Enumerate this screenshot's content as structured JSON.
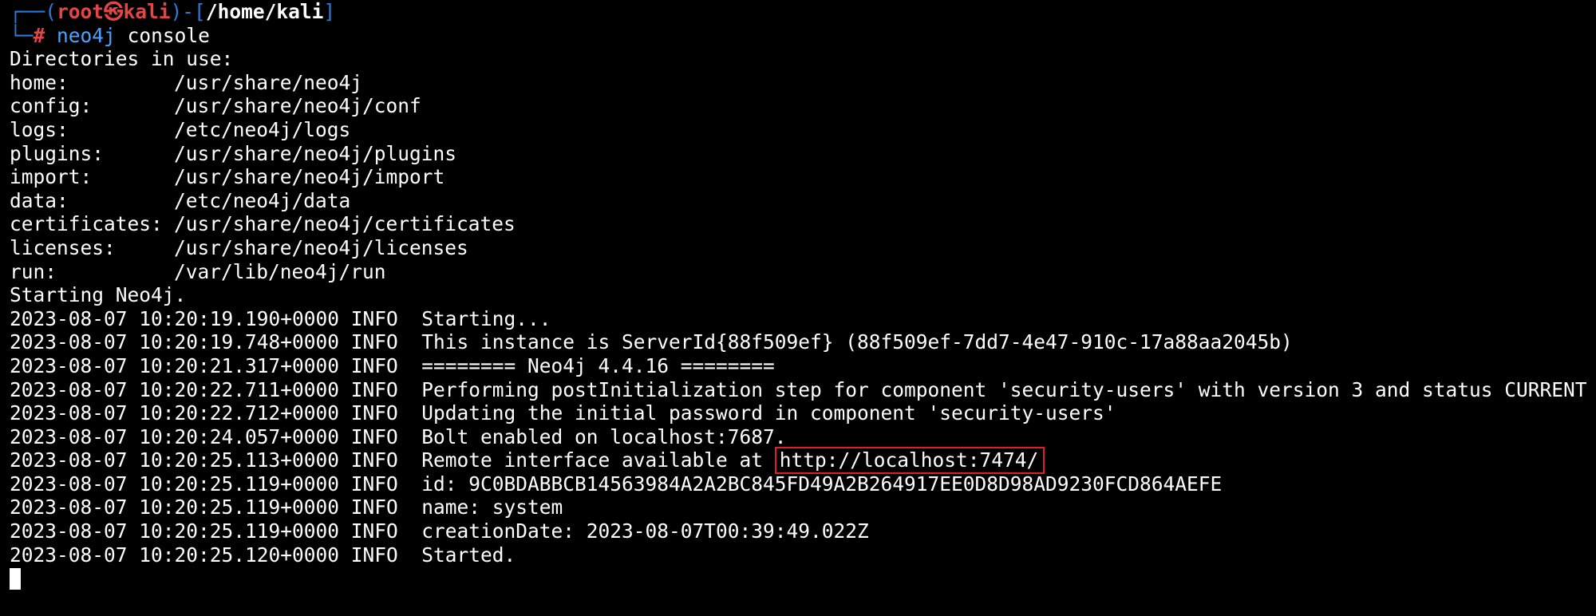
{
  "prompt": {
    "corner_top": "┌──(",
    "user": "root",
    "skull": "㉿",
    "host": "kali",
    "mid": ")-[",
    "path": "/home/kali",
    "close": "]",
    "corner_bottom": "└─",
    "hash": "#",
    "command_name": "neo4j",
    "command_args": "console"
  },
  "directories_header": "Directories in use:",
  "directories": [
    {
      "label": "home:",
      "path": "/usr/share/neo4j"
    },
    {
      "label": "config:",
      "path": "/usr/share/neo4j/conf"
    },
    {
      "label": "logs:",
      "path": "/etc/neo4j/logs"
    },
    {
      "label": "plugins:",
      "path": "/usr/share/neo4j/plugins"
    },
    {
      "label": "import:",
      "path": "/usr/share/neo4j/import"
    },
    {
      "label": "data:",
      "path": "/etc/neo4j/data"
    },
    {
      "label": "certificates:",
      "path": "/usr/share/neo4j/certificates"
    },
    {
      "label": "licenses:",
      "path": "/usr/share/neo4j/licenses"
    },
    {
      "label": "run:",
      "path": "/var/lib/neo4j/run"
    }
  ],
  "starting_text": "Starting Neo4j.",
  "log_lines": [
    "2023-08-07 10:20:19.190+0000 INFO  Starting...",
    "2023-08-07 10:20:19.748+0000 INFO  This instance is ServerId{88f509ef} (88f509ef-7dd7-4e47-910c-17a88aa2045b)",
    "2023-08-07 10:20:21.317+0000 INFO  ======== Neo4j 4.4.16 ========",
    "2023-08-07 10:20:22.711+0000 INFO  Performing postInitialization step for component 'security-users' with version 3 and status CURRENT",
    "2023-08-07 10:20:22.712+0000 INFO  Updating the initial password in component 'security-users'",
    "2023-08-07 10:20:24.057+0000 INFO  Bolt enabled on localhost:7687."
  ],
  "remote_line": {
    "prefix": "2023-08-07 10:20:25.113+0000 INFO  Remote interface available at",
    "url": "http://localhost:7474/"
  },
  "log_lines_after": [
    "2023-08-07 10:20:25.119+0000 INFO  id: 9C0BDABBCB14563984A2A2BC845FD49A2B264917EE0D8D98AD9230FCD864AEFE",
    "2023-08-07 10:20:25.119+0000 INFO  name: system",
    "2023-08-07 10:20:25.119+0000 INFO  creationDate: 2023-08-07T00:39:49.022Z",
    "2023-08-07 10:20:25.120+0000 INFO  Started."
  ],
  "colors": {
    "background": "#000000",
    "prompt_frame": "#2e7bd6",
    "prompt_user": "#e64545",
    "command": "#4aa3ff",
    "highlight_box": "#e02020"
  }
}
